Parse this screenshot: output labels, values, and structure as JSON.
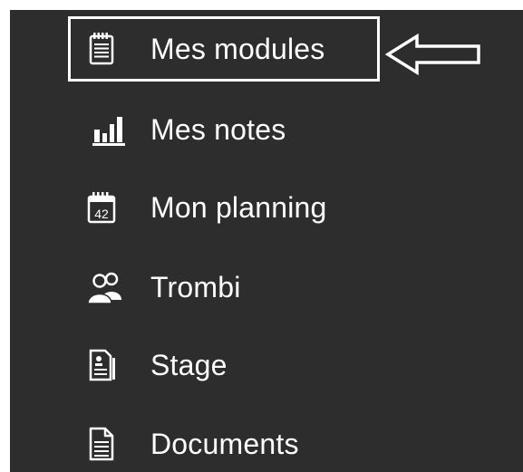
{
  "menu": {
    "items": [
      {
        "id": "modules",
        "label": "Mes modules",
        "icon": "notepad-icon",
        "highlighted": true
      },
      {
        "id": "notes",
        "label": "Mes notes",
        "icon": "bar-chart-icon",
        "highlighted": false
      },
      {
        "id": "planning",
        "label": "Mon planning",
        "icon": "calendar-icon",
        "calendar_number": "42",
        "highlighted": false
      },
      {
        "id": "trombi",
        "label": "Trombi",
        "icon": "users-icon",
        "highlighted": false
      },
      {
        "id": "stage",
        "label": "Stage",
        "icon": "id-document-icon",
        "highlighted": false
      },
      {
        "id": "documents",
        "label": "Documents",
        "icon": "document-icon",
        "highlighted": false
      }
    ]
  },
  "annotation": {
    "highlight_color": "#ffffff",
    "arrow_icon": "left-arrow-outline-icon"
  },
  "colors": {
    "panel_background": "#2d2d2d",
    "text": "#ffffff",
    "outer_background": "#ffffff"
  }
}
